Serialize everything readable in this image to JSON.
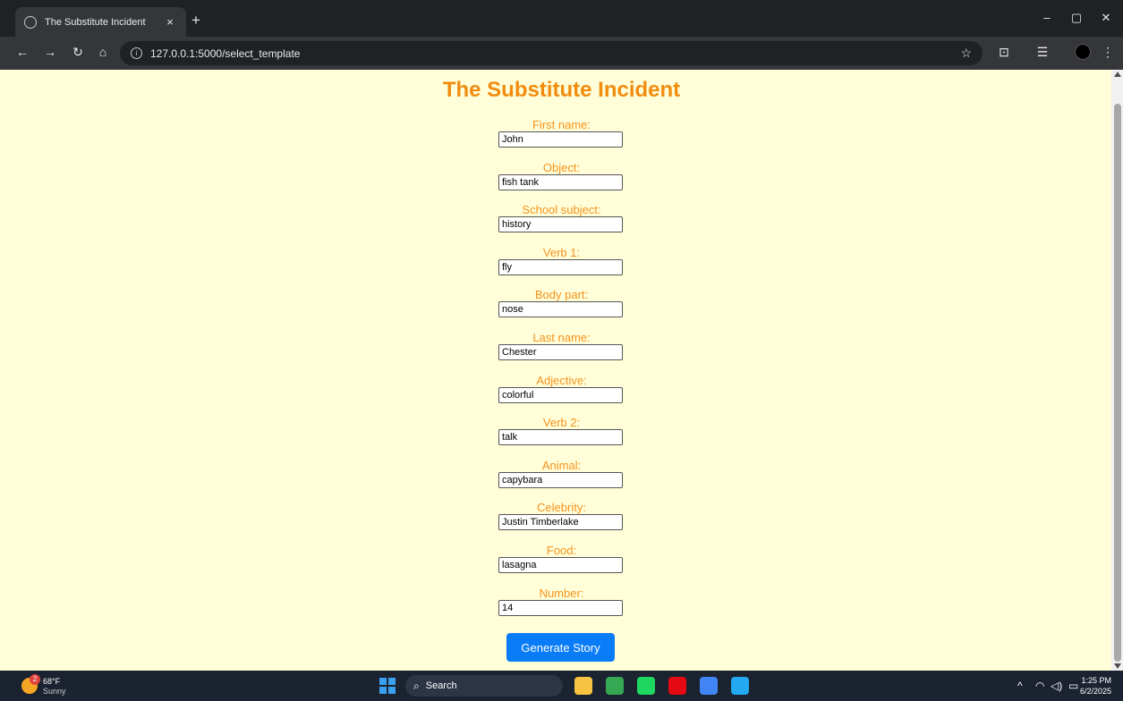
{
  "browser": {
    "tab_title": "The Substitute Incident",
    "tab_close": "×",
    "new_tab": "+",
    "url": "127.0.0.1:5000/select_template",
    "controls": {
      "minimize": "–",
      "restore": "▢",
      "close": "✕"
    },
    "nav": {
      "back": "←",
      "forward": "→",
      "reload": "↻",
      "home": "⌂"
    },
    "toolbar_icons": {
      "star": "☆",
      "extensions": "⊡",
      "reading": "☰",
      "menu": "⋮"
    }
  },
  "page": {
    "title": "The Substitute Incident",
    "fields": [
      {
        "label": "First name:",
        "value": "John"
      },
      {
        "label": "Object:",
        "value": "fish tank"
      },
      {
        "label": "School subject:",
        "value": "history"
      },
      {
        "label": "Verb 1:",
        "value": "fly"
      },
      {
        "label": "Body part:",
        "value": "nose"
      },
      {
        "label": "Last name:",
        "value": "Chester"
      },
      {
        "label": "Adjective:",
        "value": "colorful"
      },
      {
        "label": "Verb 2:",
        "value": "talk"
      },
      {
        "label": "Animal:",
        "value": "capybara"
      },
      {
        "label": "Celebrity:",
        "value": "Justin Timberlake"
      },
      {
        "label": "Food:",
        "value": "lasagna"
      },
      {
        "label": "Number:",
        "value": "14"
      }
    ],
    "submit_label": "Generate Story"
  },
  "taskbar": {
    "weather_badge": "2",
    "weather_temp": "68°F",
    "weather_condition": "Sunny",
    "search_label": "Search",
    "search_icon": "⌕",
    "tray_icons": {
      "chevron": "^",
      "wifi": "◠",
      "volume": "◁)",
      "battery": "▭"
    },
    "time": "1:25 PM",
    "date": "6/2/2025",
    "apps": [
      {
        "name": "file-explorer",
        "color": "#f6c343"
      },
      {
        "name": "chrome",
        "color": "#34a853"
      },
      {
        "name": "spotify",
        "color": "#1ed760"
      },
      {
        "name": "netflix",
        "color": "#e50914"
      },
      {
        "name": "chrome-profile",
        "color": "#4285f4"
      },
      {
        "name": "vscode",
        "color": "#23a9f2"
      }
    ]
  }
}
